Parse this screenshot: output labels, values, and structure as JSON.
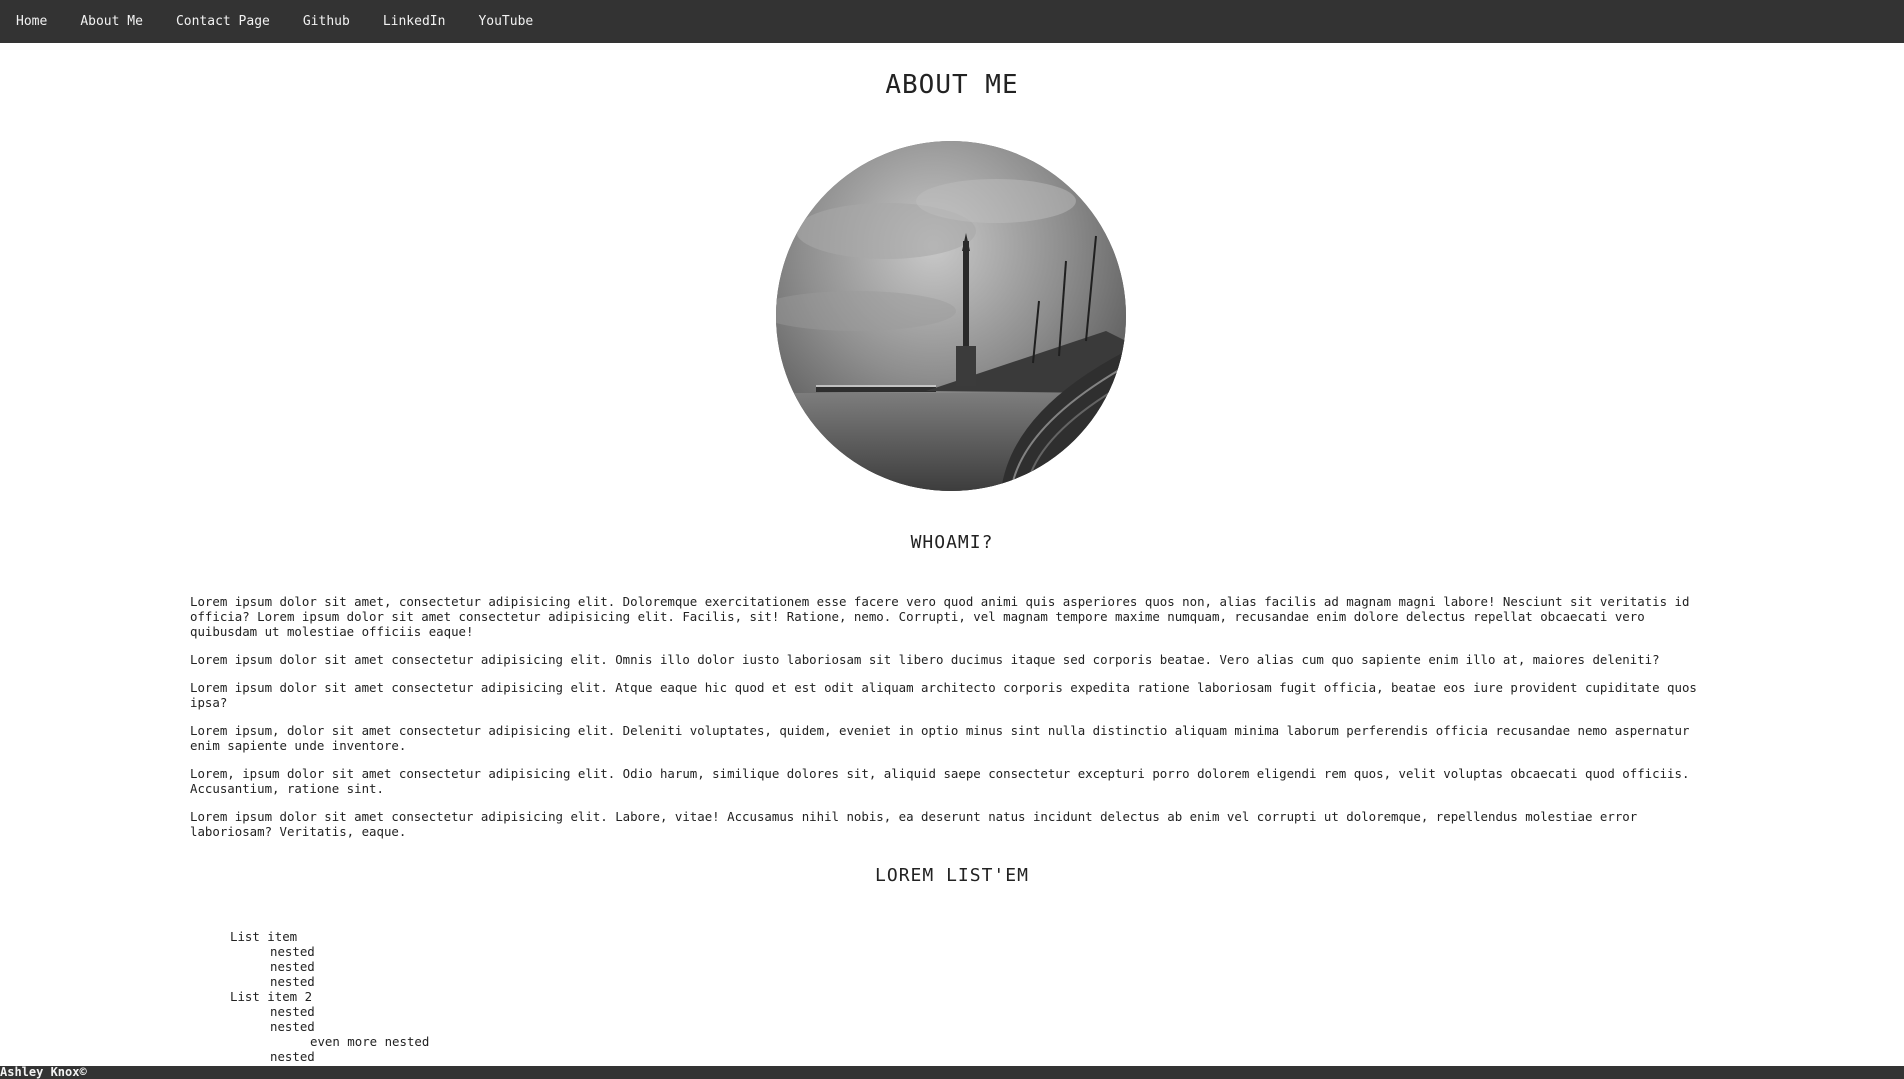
{
  "nav": {
    "items": [
      "Home",
      "About Me",
      "Contact Page",
      "Github",
      "LinkedIn",
      "YouTube"
    ]
  },
  "main": {
    "title": "ABOUT ME",
    "whoami_title": "WHOAMI?",
    "paragraphs": [
      "Lorem ipsum dolor sit amet, consectetur adipisicing elit. Doloremque exercitationem esse facere vero quod animi quis asperiores quos non, alias facilis ad magnam magni labore! Nesciunt sit veritatis id officia? Lorem ipsum dolor sit amet consectetur adipisicing elit. Facilis, sit! Ratione, nemo. Corrupti, vel magnam tempore maxime numquam, recusandae enim dolore delectus repellat obcaecati vero quibusdam ut molestiae officiis eaque!",
      "Lorem ipsum dolor sit amet consectetur adipisicing elit. Omnis illo dolor iusto laboriosam sit libero ducimus itaque sed corporis beatae. Vero alias cum quo sapiente enim illo at, maiores deleniti?",
      "Lorem ipsum dolor sit amet consectetur adipisicing elit. Atque eaque hic quod et est odit aliquam architecto corporis expedita ratione laboriosam fugit officia, beatae eos iure provident cupiditate quos ipsa?",
      "Lorem ipsum, dolor sit amet consectetur adipisicing elit. Deleniti voluptates, quidem, eveniet in optio minus sint nulla distinctio aliquam minima laborum perferendis officia recusandae nemo aspernatur enim sapiente unde inventore.",
      "Lorem, ipsum dolor sit amet consectetur adipisicing elit. Odio harum, similique dolores sit, aliquid saepe consectetur excepturi porro dolorem eligendi rem quos, velit voluptas obcaecati quod officiis. Accusantium, ratione sint.",
      "Lorem ipsum dolor sit amet consectetur adipisicing elit. Labore, vitae! Accusamus nihil nobis, ea deserunt natus incidunt delectus ab enim vel corrupti ut doloremque, repellendus molestiae error laboriosam? Veritatis, eaque."
    ],
    "list_title": "LOREM LIST'EM",
    "list": {
      "item1": "List item",
      "item1_nested": [
        "nested",
        "nested",
        "nested"
      ],
      "item2": "List item 2",
      "item2_nested_a": "nested",
      "item2_nested_b": "nested",
      "item2_even_more": "even more nested",
      "item2_nested_c": "nested"
    }
  },
  "footer": {
    "text": "Ashley Knox©"
  }
}
